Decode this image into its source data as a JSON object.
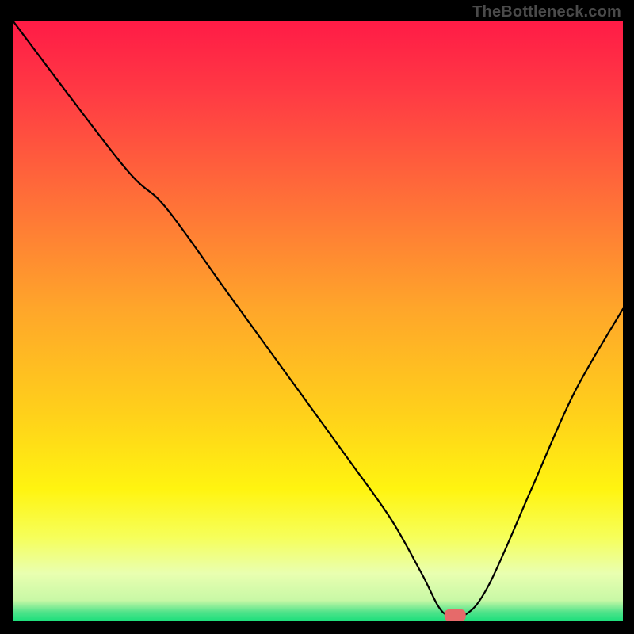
{
  "watermark": "TheBottleneck.com",
  "chart_data": {
    "type": "line",
    "title": "",
    "xlabel": "",
    "ylabel": "",
    "xlim": [
      0,
      100
    ],
    "ylim": [
      0,
      100
    ],
    "grid": false,
    "legend": false,
    "annotations": [],
    "series": [
      {
        "name": "curve",
        "x": [
          0,
          18,
          25,
          35,
          45,
          55,
          62,
          67,
          70.5,
          74,
          78,
          85,
          92,
          100
        ],
        "values": [
          100,
          76,
          69,
          55,
          41,
          27,
          17,
          8,
          1.5,
          1,
          6,
          22,
          38,
          52
        ]
      }
    ],
    "marker": {
      "x": 72.5,
      "y": 1,
      "color": "#e66a6a",
      "width": 3.5,
      "height": 2
    },
    "gradient_stops": [
      {
        "offset": 0.0,
        "color": "#ff1b46"
      },
      {
        "offset": 0.12,
        "color": "#ff3a44"
      },
      {
        "offset": 0.3,
        "color": "#ff7038"
      },
      {
        "offset": 0.48,
        "color": "#ffa62a"
      },
      {
        "offset": 0.66,
        "color": "#ffd21a"
      },
      {
        "offset": 0.78,
        "color": "#fff410"
      },
      {
        "offset": 0.86,
        "color": "#f6ff5a"
      },
      {
        "offset": 0.92,
        "color": "#e9ffb0"
      },
      {
        "offset": 0.965,
        "color": "#c8f8a6"
      },
      {
        "offset": 0.985,
        "color": "#4fe38a"
      },
      {
        "offset": 1.0,
        "color": "#1adf7b"
      }
    ]
  }
}
